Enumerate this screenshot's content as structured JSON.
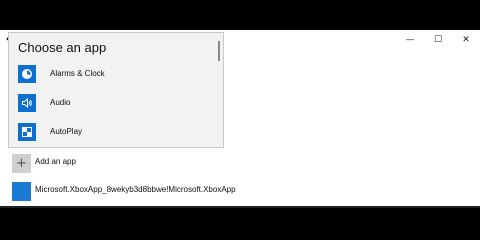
{
  "window": {
    "controls": {
      "minimize": "—",
      "maximize": "☐",
      "close": "✕"
    }
  },
  "back": {
    "glyph": "←"
  },
  "dialog": {
    "title": "Choose an app",
    "items": [
      {
        "label": "Alarms & Clock",
        "icon": "alarm-clock-icon"
      },
      {
        "label": "Audio",
        "icon": "speaker-icon"
      },
      {
        "label": "AutoPlay",
        "icon": "autoplay-icon"
      }
    ]
  },
  "main": {
    "add_app": {
      "label": "Add an app",
      "glyph": "+"
    },
    "app": {
      "label": "Microsoft.XboxApp_8wekyb3d8bbwe!Microsoft.XboxApp"
    }
  },
  "colors": {
    "accent": "#0f6fd0",
    "dialog_bg": "#f2f2f2"
  }
}
